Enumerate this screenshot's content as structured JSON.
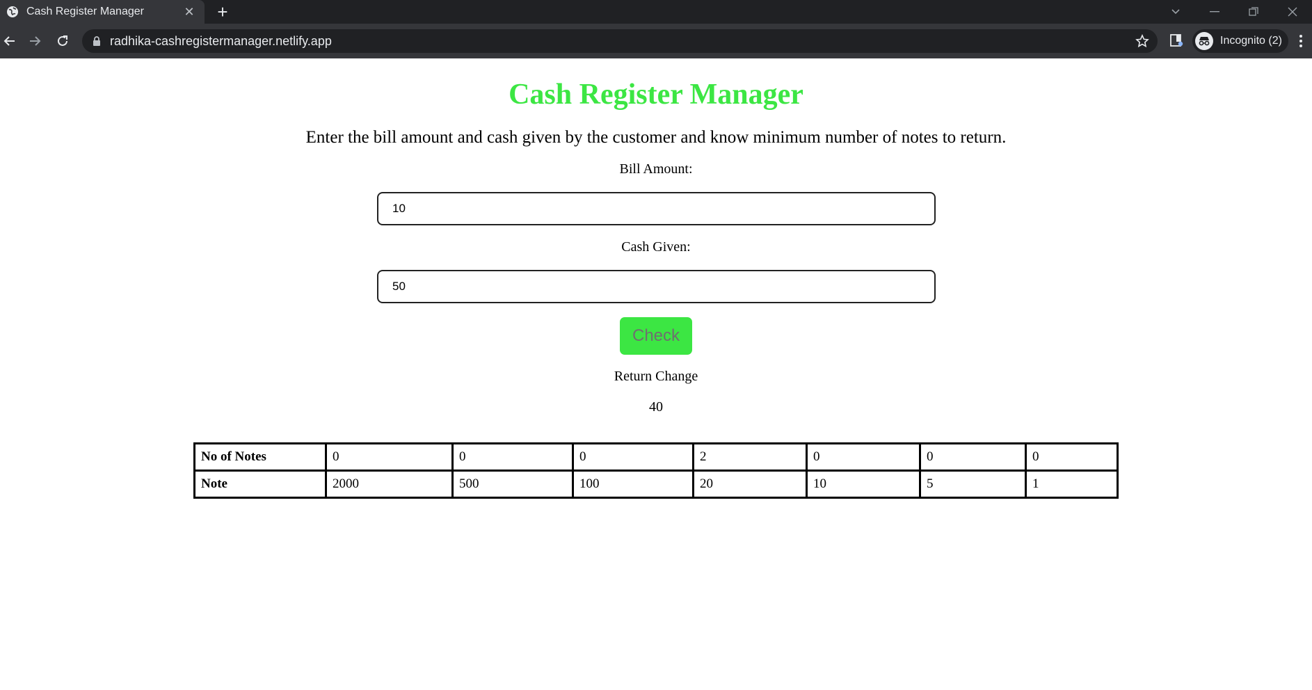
{
  "browser": {
    "tab_title": "Cash Register Manager",
    "url": "radhika-cashregistermanager.netlify.app",
    "profile_label": "Incognito (2)",
    "icons": [
      "globe-icon",
      "close-icon",
      "plus-icon",
      "back-arrow-icon",
      "forward-arrow-icon",
      "reload-icon",
      "lock-icon",
      "star-icon",
      "extension-icon",
      "incognito-icon",
      "kebab-menu-icon",
      "minimize-icon",
      "restore-icon",
      "window-close-icon",
      "tab-search-icon"
    ]
  },
  "page": {
    "title": "Cash Register Manager",
    "subtitle": "Enter the bill amount and cash given by the customer and know minimum number of notes to return.",
    "bill_label": "Bill Amount:",
    "bill_value": "10",
    "cash_label": "Cash Given:",
    "cash_value": "50",
    "check_label": "Check",
    "return_label": "Return Change",
    "return_value": "40",
    "accent_color": "#3ce643"
  },
  "table": {
    "rows": [
      {
        "header": "No of Notes",
        "cells": [
          "0",
          "0",
          "0",
          "2",
          "0",
          "0",
          "0"
        ]
      },
      {
        "header": "Note",
        "cells": [
          "2000",
          "500",
          "100",
          "20",
          "10",
          "5",
          "1"
        ]
      }
    ]
  }
}
